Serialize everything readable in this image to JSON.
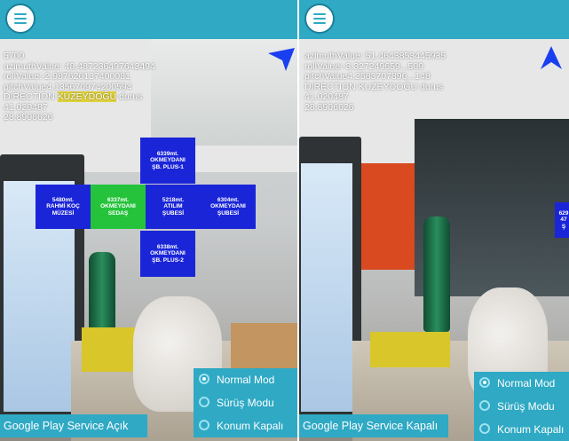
{
  "left": {
    "debug": {
      "line1": "5700",
      "line2": "azimuthValue: 48.487236497643494",
      "line3": "rollValue:-2.987626137400081",
      "line4": "pitchValue4.135670974200594",
      "line5_prefix": "DIRECTION ",
      "line5_highlight": "KUZEYDOĞU",
      "line5_suffix": " durus",
      "line6": "41.020487",
      "line7": "28.8906626"
    },
    "pois": [
      {
        "distance": "6339mt.",
        "name1": "OKMEYDANI",
        "name2": "ŞB. PLUS-1"
      },
      {
        "distance": "5480mt.",
        "name1": "RAHMİ KOÇ",
        "name2": "MÜZESİ"
      },
      {
        "distance": "6337mt.",
        "name1": "OKMEYDANI",
        "name2": "SEDAŞ"
      },
      {
        "distance": "5218mt.",
        "name1": "ATILIM",
        "name2": "ŞUBESİ"
      },
      {
        "distance": "6304mt.",
        "name1": "OKMEYDANI",
        "name2": "ŞUBESİ"
      },
      {
        "distance": "6338mt.",
        "name1": "OKMEYDANI",
        "name2": "ŞB. PLUS-2"
      }
    ],
    "modes": [
      "Normal Mod",
      "Sürüş Modu",
      "Konum Kapalı"
    ],
    "service": "Google Play Service Açık"
  },
  "right": {
    "debug": {
      "line2": "azimuthValue: 51.4643853445935",
      "line3": "rollValue:-3.327249659...509",
      "line4": "pitchValue4.2583707896...148",
      "line5": "DIRECTION KUZEYDOĞU durus",
      "line6": "41.020487",
      "line7": "28.8906626"
    },
    "poi_partial": {
      "distance": "629",
      "name1": "47",
      "name2": "Ş"
    },
    "modes": [
      "Normal Mod",
      "Sürüş Modu",
      "Konum Kapalı"
    ],
    "service": "Google Play Service Kapalı"
  },
  "colors": {
    "accent": "#2fa9c4",
    "poi_blue": "#1b25d8",
    "poi_green": "#25c33b",
    "arrow": "#1a3ff0"
  },
  "icons": [
    "menu-icon",
    "navigation-arrow-icon"
  ]
}
